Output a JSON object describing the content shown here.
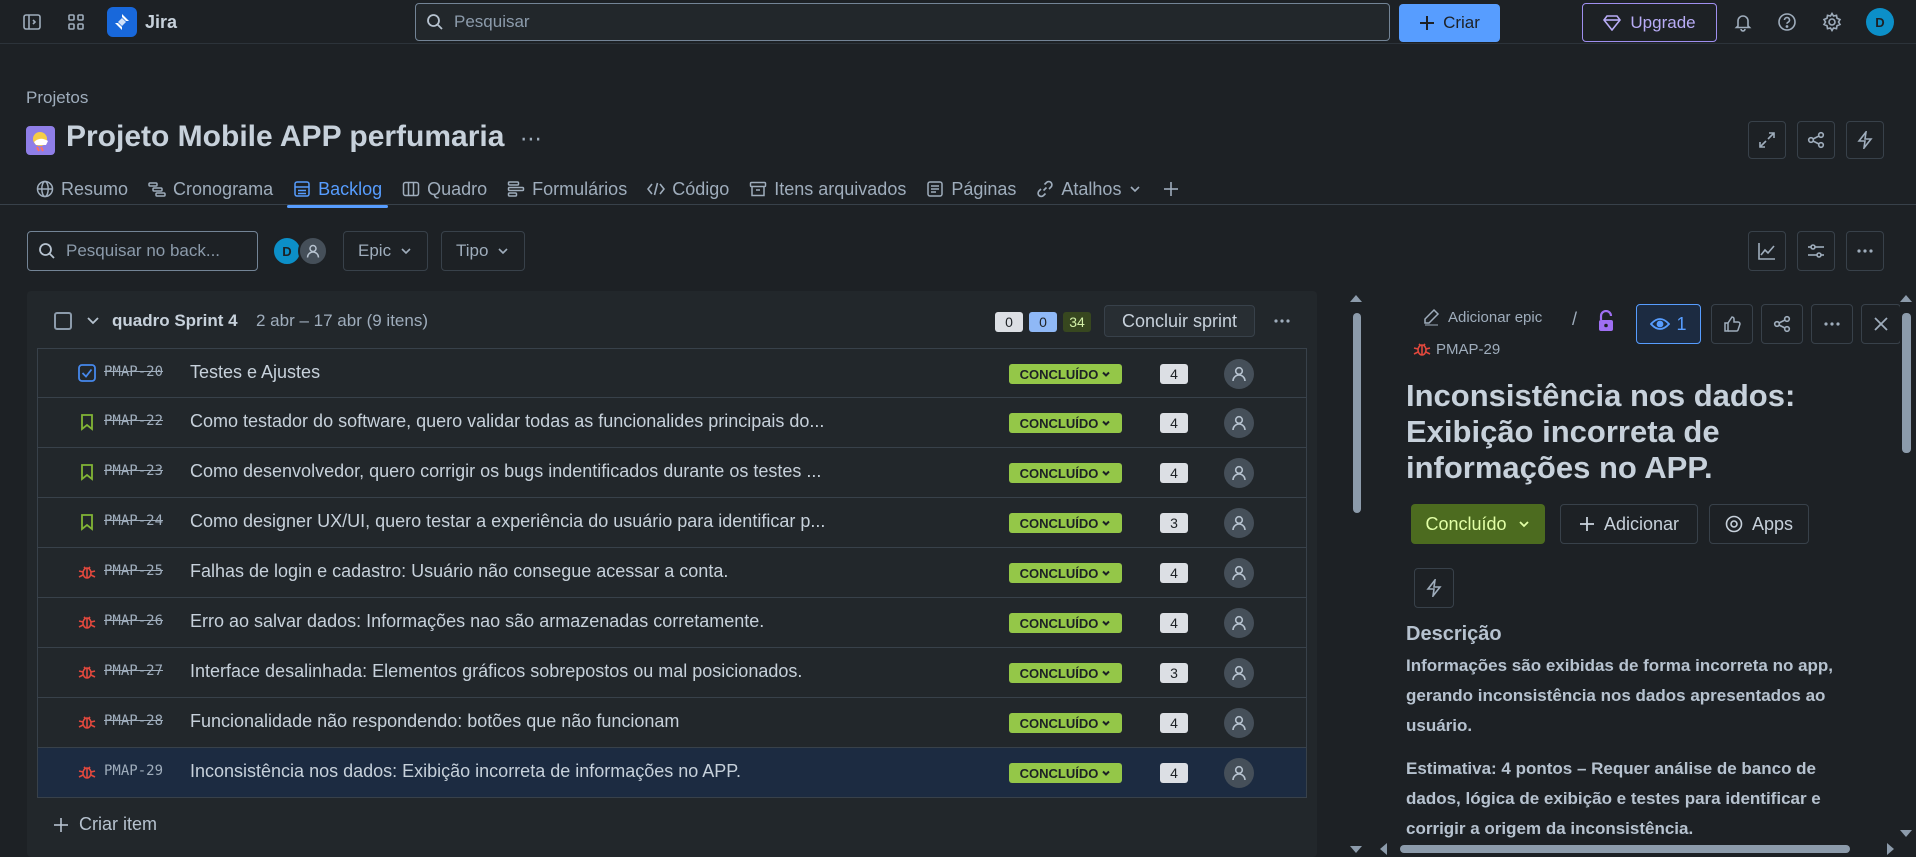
{
  "app": {
    "name": "Jira"
  },
  "topbar": {
    "search_placeholder": "Pesquisar",
    "create_label": "Criar",
    "upgrade_label": "Upgrade",
    "avatar_initial": "D"
  },
  "project": {
    "breadcrumb": "Projetos",
    "title": "Projeto Mobile APP perfumaria",
    "more": "⋯"
  },
  "tabs": [
    {
      "label": "Resumo"
    },
    {
      "label": "Cronograma"
    },
    {
      "label": "Backlog",
      "active": true
    },
    {
      "label": "Quadro"
    },
    {
      "label": "Formulários"
    },
    {
      "label": "Código"
    },
    {
      "label": "Itens arquivados"
    },
    {
      "label": "Páginas"
    },
    {
      "label": "Atalhos"
    }
  ],
  "toolbar": {
    "search_placeholder": "Pesquisar no back...",
    "avatar_initial": "D",
    "epic_label": "Epic",
    "type_label": "Tipo"
  },
  "sprint": {
    "name": "quadro Sprint 4",
    "dates": "2 abr – 17 abr (9 itens)",
    "count_todo": "0",
    "count_progress": "0",
    "count_done": "34",
    "complete_label": "Concluir sprint",
    "issues": [
      {
        "type": "task",
        "key": "PMAP-20",
        "summary": "Testes e Ajustes",
        "status": "CONCLUÍDO",
        "points": "4"
      },
      {
        "type": "story",
        "key": "PMAP-22",
        "summary": "Como testador do software, quero validar todas as funcionalides principais do...",
        "status": "CONCLUÍDO",
        "points": "4"
      },
      {
        "type": "story",
        "key": "PMAP-23",
        "summary": "Como desenvolvedor, quero corrigir os bugs indentificados durante os testes ...",
        "status": "CONCLUÍDO",
        "points": "4"
      },
      {
        "type": "story",
        "key": "PMAP-24",
        "summary": "Como designer UX/UI, quero testar a experiência do usuário para identificar p...",
        "status": "CONCLUÍDO",
        "points": "3"
      },
      {
        "type": "bug",
        "key": "PMAP-25",
        "summary": "Falhas de login e cadastro: Usuário não consegue acessar a conta.",
        "status": "CONCLUÍDO",
        "points": "4"
      },
      {
        "type": "bug",
        "key": "PMAP-26",
        "summary": "Erro ao salvar dados: Informações nao são armazenadas corretamente.",
        "status": "CONCLUÍDO",
        "points": "4"
      },
      {
        "type": "bug",
        "key": "PMAP-27",
        "summary": "Interface desalinhada: Elementos gráficos sobrepostos ou mal posicionados.",
        "status": "CONCLUÍDO",
        "points": "3"
      },
      {
        "type": "bug",
        "key": "PMAP-28",
        "summary": "Funcionalidade não respondendo: botões que não funcionam",
        "status": "CONCLUÍDO",
        "points": "4"
      },
      {
        "type": "bug",
        "key": "PMAP-29",
        "summary": "Inconsistência nos dados: Exibição incorreta de informações no APP.",
        "status": "CONCLUÍDO",
        "points": "4",
        "selected": true
      }
    ],
    "create_item_label": "Criar item"
  },
  "detail": {
    "add_epic_label": "Adicionar epic",
    "separator": "/",
    "watchers_count": "1",
    "issue_key": "PMAP-29",
    "title": "Inconsistência nos dados: Exibição incorreta de informações no APP.",
    "status_label": "Concluído",
    "add_label": "Adicionar",
    "apps_label": "Apps",
    "description_label": "Descrição",
    "description_p1": "Informações são exibidas de forma incorreta no app, gerando inconsistência nos dados apresentados ao usuário.",
    "description_p2": "Estimativa: 4 pontos – Requer análise de banco de dados, lógica de exibição e testes para identificar e corrigir a origem da inconsistência."
  },
  "colors": {
    "accent": "#579dff",
    "status_done": "#94c748",
    "bug": "#e2483d",
    "story": "#82b536",
    "task": "#4688ec",
    "upgrade": "#9f8fef"
  }
}
